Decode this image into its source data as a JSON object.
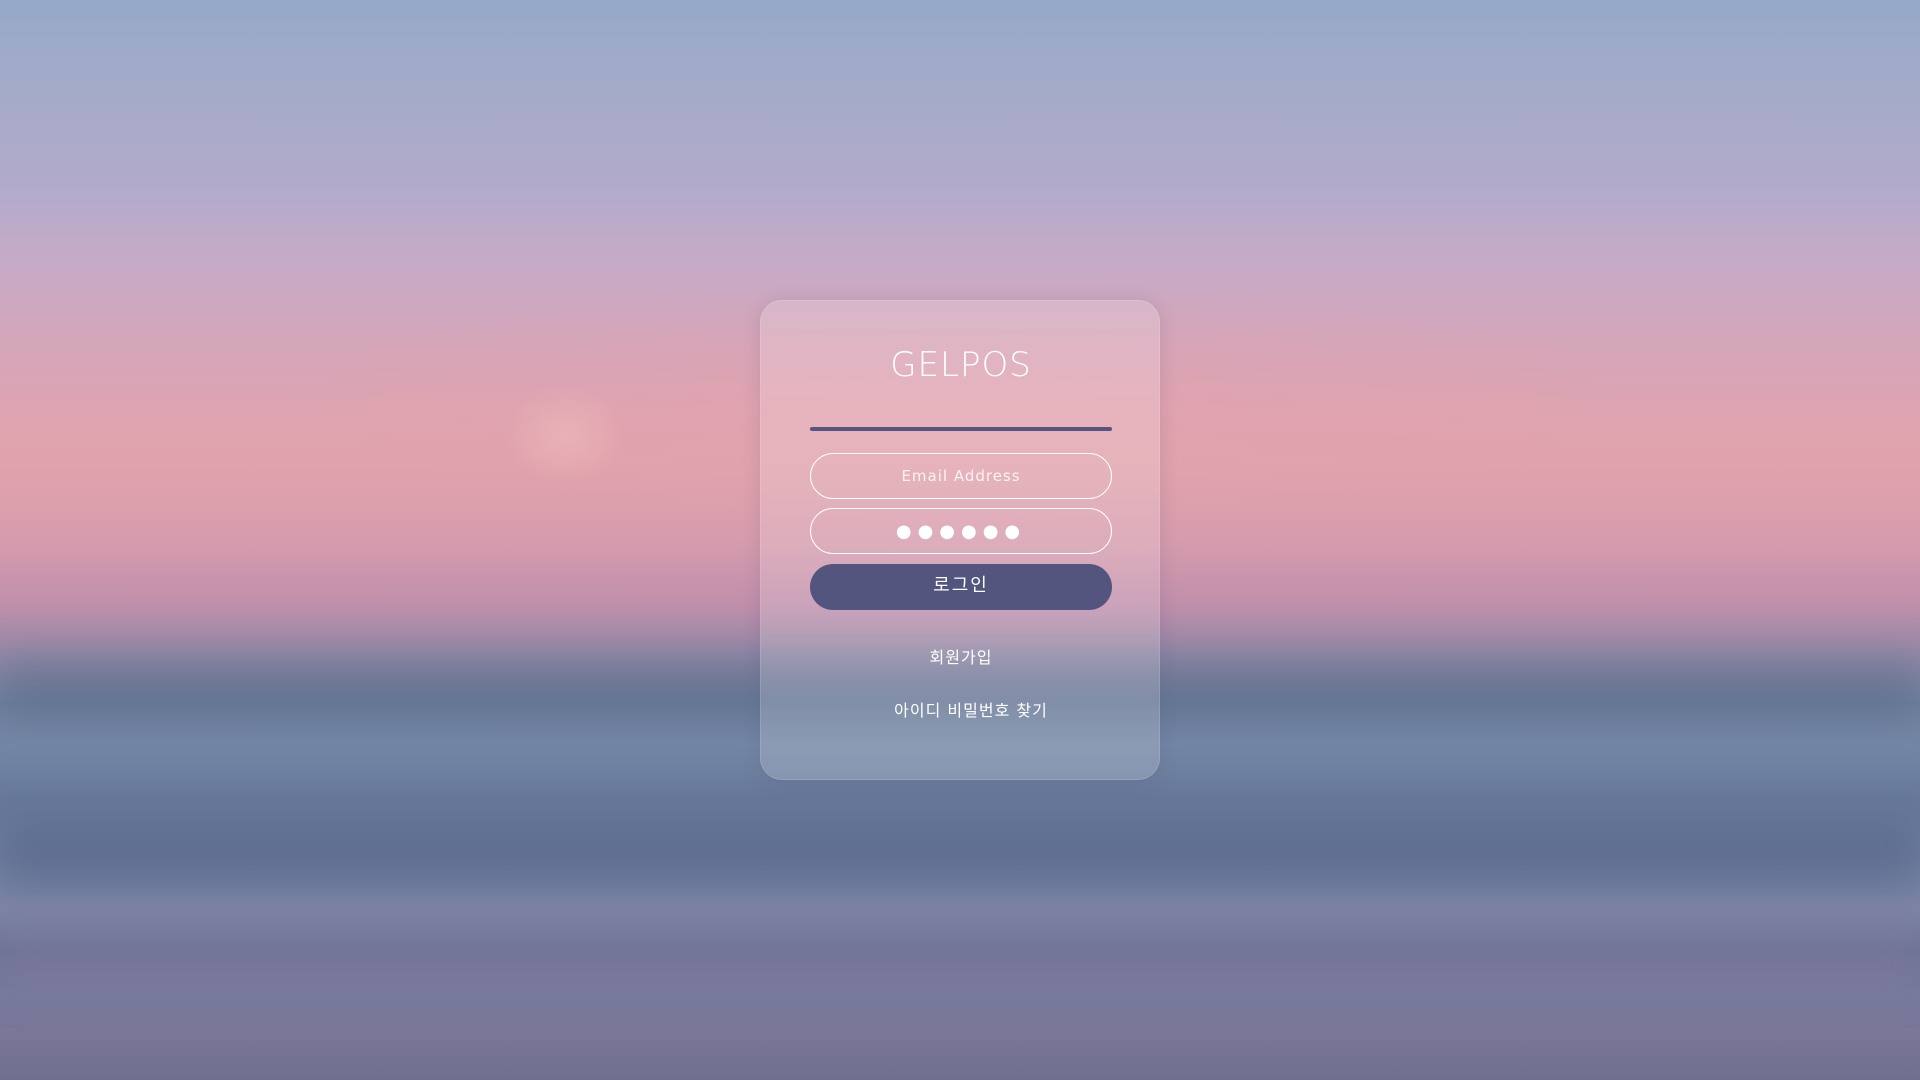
{
  "login_card": {
    "title": "GELPOS",
    "email_placeholder": "Email Address",
    "password_value": "●●●●●●",
    "login_button_label": "로그인",
    "signup_link_label": "회원가입",
    "find_account_link_label": "아이디 비밀번호 찾기"
  },
  "colors": {
    "accent": "#53557f",
    "text": "#ffffff"
  }
}
